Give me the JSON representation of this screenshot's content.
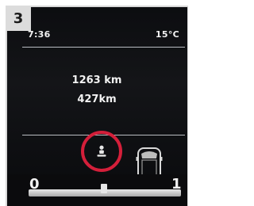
{
  "step_number": "3",
  "status_bar": {
    "time": "7:36",
    "temperature": "15°C"
  },
  "range": {
    "line1": "1263 km",
    "line2": "427km"
  },
  "gauge": {
    "min_label": "0",
    "max_label": "1"
  },
  "icons": {
    "center": "seat-occupant-icon",
    "right": "vehicle-top-view-icon"
  },
  "colors": {
    "highlight": "#d41f3a",
    "text": "#f2f2f2"
  }
}
